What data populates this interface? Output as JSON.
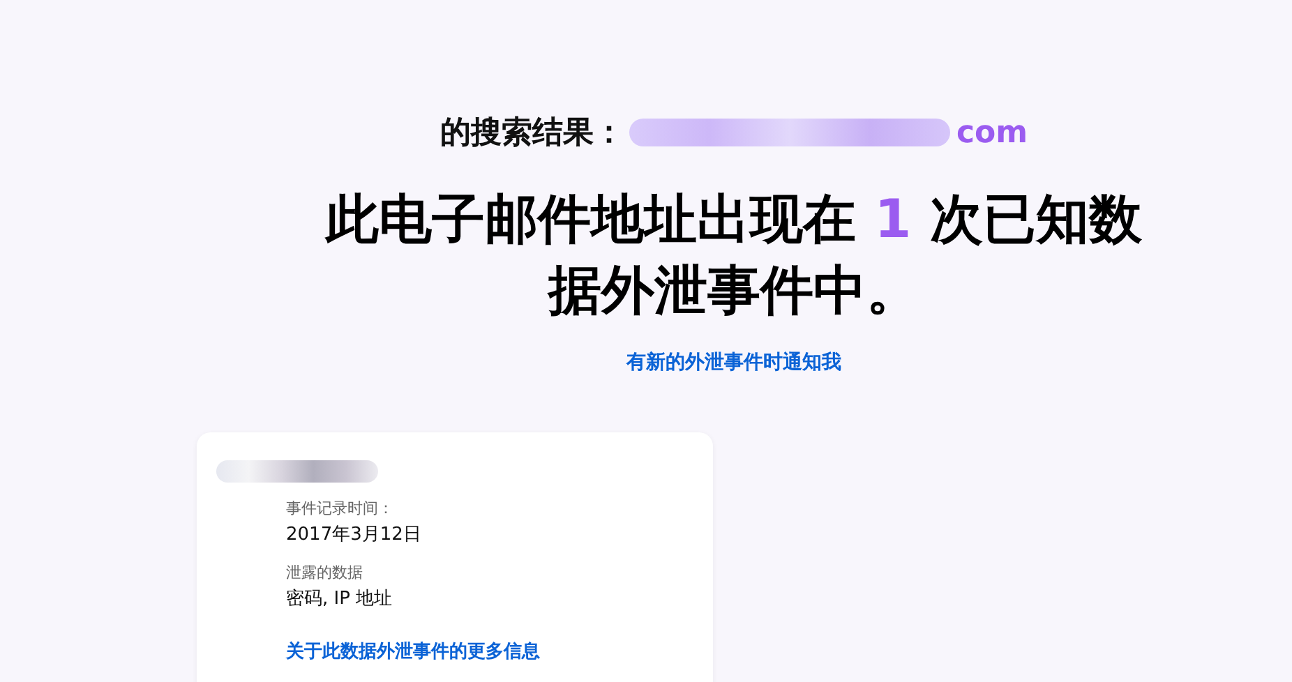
{
  "search_result": {
    "label": "的搜索结果：",
    "email_visible": "com"
  },
  "headline": {
    "before": "此电子邮件地址出现在 ",
    "count": "1",
    "after": " 次已知数据外泄事件中。"
  },
  "notify_link": "有新的外泄事件时通知我",
  "breach_card": {
    "fields": [
      {
        "label": "事件记录时间：",
        "value": "2017年3月12日"
      },
      {
        "label": "泄露的数据",
        "value": "密码, IP 地址"
      }
    ],
    "more_link": "关于此数据外泄事件的更多信息"
  }
}
